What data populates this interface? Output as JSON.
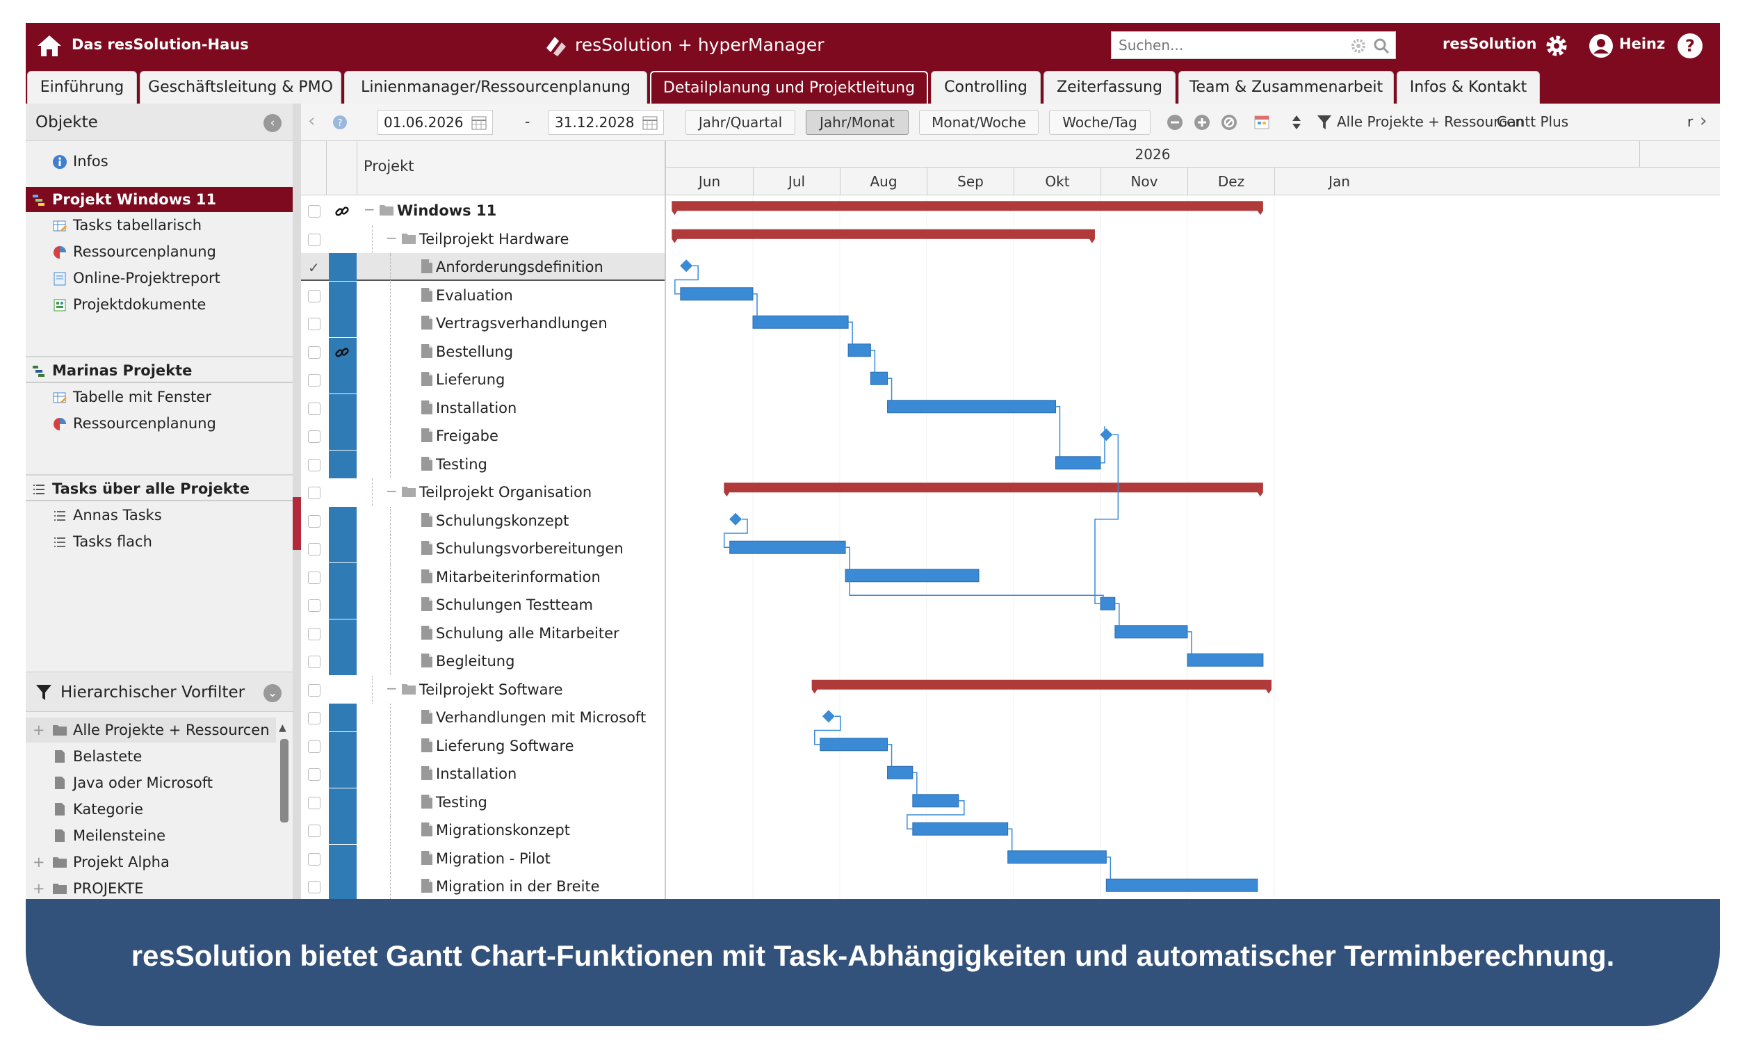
{
  "app": {
    "home_title": "Das resSolution-Haus",
    "center_title": "resSolution + hyperManager",
    "search_placeholder": "Suchen...",
    "org_label": "resSolution",
    "user_name": "Heinz",
    "brand_color": "#7d0a1e",
    "task_bar_color": "#3a8ad6",
    "summary_bar_color": "#b03a3a"
  },
  "tabs": [
    {
      "label": "Einführung"
    },
    {
      "label": "Geschäftsleitung & PMO"
    },
    {
      "label": "Linienmanager/Ressourcenplanung"
    },
    {
      "label": "Detailplanung und Projektleitung",
      "active": true
    },
    {
      "label": "Controlling"
    },
    {
      "label": "Zeiterfassung"
    },
    {
      "label": "Team & Zusammenarbeit"
    },
    {
      "label": "Infos & Kontakt"
    }
  ],
  "left": {
    "header": "Objekte",
    "infos": "Infos",
    "groups": [
      {
        "title": "Projekt Windows 11",
        "icon": "gantt-icon",
        "items": [
          "Tasks tabellarisch",
          "Ressourcenplanung",
          "Online-Projektreport",
          "Projektdokumente"
        ]
      },
      {
        "title": "Marinas Projekte",
        "icon": "gantt-icon",
        "items": [
          "Tabelle mit Fenster",
          "Ressourcenplanung"
        ]
      },
      {
        "title": "Tasks über alle Projekte",
        "icon": "list-icon",
        "items": [
          "Annas Tasks",
          "Tasks flach"
        ]
      }
    ],
    "filter_header": "Hierarchischer Vorfilter",
    "filter_tree": [
      "Alle Projekte + Ressourcen",
      "Belastete",
      "Java oder Microsoft",
      "Kategorie",
      "Meilensteine",
      "Projekt Alpha",
      "PROJEKTE"
    ]
  },
  "toolbar": {
    "date_from": "01.06.2026",
    "date_sep": "-",
    "date_to": "31.12.2028",
    "views": [
      "Jahr/Quartal",
      "Jahr/Monat",
      "Monat/Woche",
      "Woche/Tag"
    ],
    "active_view": "Jahr/Monat",
    "filter_label": "Alle Projekte + Ressourcen",
    "gantt_plus": "Gantt Plus",
    "more": "r"
  },
  "grid": {
    "column_project": "Projekt",
    "year": "2026",
    "months": [
      "Jun",
      "Jul",
      "Aug",
      "Sep",
      "Okt",
      "Nov",
      "Dez",
      "Jan"
    ],
    "rows": [
      {
        "name": "Windows 11",
        "level": 0,
        "type": "project",
        "link": true
      },
      {
        "name": "Teilprojekt Hardware",
        "level": 1,
        "type": "folder"
      },
      {
        "name": "Anforderungsdefinition",
        "level": 2,
        "type": "task",
        "checked": true,
        "selected": true
      },
      {
        "name": "Evaluation",
        "level": 2,
        "type": "task"
      },
      {
        "name": "Vertragsverhandlungen",
        "level": 2,
        "type": "task"
      },
      {
        "name": "Bestellung",
        "level": 2,
        "type": "task",
        "link": true
      },
      {
        "name": "Lieferung",
        "level": 2,
        "type": "task"
      },
      {
        "name": "Installation",
        "level": 2,
        "type": "task"
      },
      {
        "name": "Freigabe",
        "level": 2,
        "type": "task"
      },
      {
        "name": "Testing",
        "level": 2,
        "type": "task"
      },
      {
        "name": "Teilprojekt Organisation",
        "level": 1,
        "type": "folder"
      },
      {
        "name": "Schulungskonzept",
        "level": 2,
        "type": "task"
      },
      {
        "name": "Schulungsvorbereitungen",
        "level": 2,
        "type": "task"
      },
      {
        "name": "Mitarbeiterinformation",
        "level": 2,
        "type": "task"
      },
      {
        "name": "Schulungen Testteam",
        "level": 2,
        "type": "task"
      },
      {
        "name": "Schulung alle Mitarbeiter",
        "level": 2,
        "type": "task"
      },
      {
        "name": "Begleitung",
        "level": 2,
        "type": "task"
      },
      {
        "name": "Teilprojekt Software",
        "level": 1,
        "type": "folder"
      },
      {
        "name": "Verhandlungen mit Microsoft",
        "level": 2,
        "type": "task"
      },
      {
        "name": "Lieferung Software",
        "level": 2,
        "type": "task"
      },
      {
        "name": "Installation",
        "level": 2,
        "type": "task"
      },
      {
        "name": "Testing",
        "level": 2,
        "type": "task"
      },
      {
        "name": "Migrationskonzept",
        "level": 2,
        "type": "task"
      },
      {
        "name": "Migration - Pilot",
        "level": 2,
        "type": "task"
      },
      {
        "name": "Migration in der Breite",
        "level": 2,
        "type": "task"
      }
    ]
  },
  "gantt": [
    {
      "row": 0,
      "type": "summary",
      "start": "2026-06-03",
      "end": "2026-12-28"
    },
    {
      "row": 1,
      "type": "summary",
      "start": "2026-06-03",
      "end": "2026-10-30"
    },
    {
      "row": 2,
      "type": "milestone",
      "start": "2026-06-08"
    },
    {
      "row": 3,
      "type": "task",
      "start": "2026-06-06",
      "end": "2026-07-01"
    },
    {
      "row": 4,
      "type": "task",
      "start": "2026-07-01",
      "end": "2026-08-04"
    },
    {
      "row": 5,
      "type": "task",
      "start": "2026-08-04",
      "end": "2026-08-12"
    },
    {
      "row": 6,
      "type": "task",
      "start": "2026-08-12",
      "end": "2026-08-18"
    },
    {
      "row": 7,
      "type": "task",
      "start": "2026-08-18",
      "end": "2026-10-16"
    },
    {
      "row": 8,
      "type": "milestone",
      "start": "2026-11-03"
    },
    {
      "row": 9,
      "type": "task",
      "start": "2026-10-16",
      "end": "2026-11-01"
    },
    {
      "row": 10,
      "type": "summary",
      "start": "2026-06-21",
      "end": "2026-12-28"
    },
    {
      "row": 11,
      "type": "milestone",
      "start": "2026-06-25"
    },
    {
      "row": 12,
      "type": "task",
      "start": "2026-06-23",
      "end": "2026-08-03"
    },
    {
      "row": 13,
      "type": "task",
      "start": "2026-08-03",
      "end": "2026-09-19"
    },
    {
      "row": 14,
      "type": "task",
      "start": "2026-11-01",
      "end": "2026-11-06"
    },
    {
      "row": 15,
      "type": "task",
      "start": "2026-11-06",
      "end": "2026-12-01"
    },
    {
      "row": 16,
      "type": "task",
      "start": "2026-12-01",
      "end": "2026-12-28"
    },
    {
      "row": 17,
      "type": "summary",
      "start": "2026-07-22",
      "end": "2026-12-31"
    },
    {
      "row": 18,
      "type": "milestone",
      "start": "2026-07-28"
    },
    {
      "row": 19,
      "type": "task",
      "start": "2026-07-25",
      "end": "2026-08-18"
    },
    {
      "row": 20,
      "type": "task",
      "start": "2026-08-18",
      "end": "2026-08-27"
    },
    {
      "row": 21,
      "type": "task",
      "start": "2026-08-27",
      "end": "2026-09-12"
    },
    {
      "row": 22,
      "type": "task",
      "start": "2026-08-27",
      "end": "2026-09-29"
    },
    {
      "row": 23,
      "type": "task",
      "start": "2026-09-29",
      "end": "2026-11-03"
    },
    {
      "row": 24,
      "type": "task",
      "start": "2026-11-03",
      "end": "2026-12-26"
    }
  ],
  "dependencies": [
    [
      2,
      3
    ],
    [
      3,
      4
    ],
    [
      4,
      5
    ],
    [
      5,
      6
    ],
    [
      6,
      7
    ],
    [
      7,
      9
    ],
    [
      9,
      8
    ],
    [
      8,
      14
    ],
    [
      11,
      12
    ],
    [
      12,
      14
    ],
    [
      14,
      15
    ],
    [
      15,
      16
    ],
    [
      18,
      19
    ],
    [
      19,
      20
    ],
    [
      20,
      21
    ],
    [
      21,
      22
    ],
    [
      22,
      23
    ],
    [
      23,
      24
    ]
  ],
  "footer": {
    "caption": "resSolution bietet Gantt Chart-Funktionen mit Task-Abhängigkeiten und automatischer Terminberechnung."
  }
}
